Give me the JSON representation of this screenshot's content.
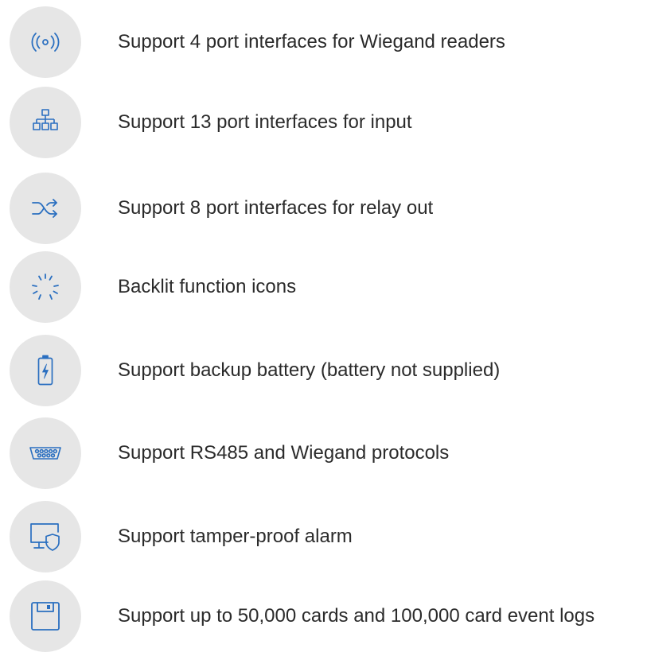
{
  "colors": {
    "icon_blue": "#2a6fc0",
    "circle_grey": "#e6e6e6",
    "text": "#2b2b2b"
  },
  "features": [
    {
      "icon": "wireless-signal-icon",
      "text": "Support 4 port interfaces for Wiegand readers"
    },
    {
      "icon": "network-hierarchy-icon",
      "text": "Support 13 port interfaces for input"
    },
    {
      "icon": "shuffle-arrows-icon",
      "text": "Support 8 port interfaces for relay out"
    },
    {
      "icon": "backlight-rays-icon",
      "text": "Backlit function icons"
    },
    {
      "icon": "battery-charge-icon",
      "text": "Support backup battery (battery not supplied)"
    },
    {
      "icon": "serial-port-icon",
      "text": "Support RS485 and Wiegand protocols"
    },
    {
      "icon": "monitor-shield-icon",
      "text": "Support tamper-proof alarm"
    },
    {
      "icon": "floppy-disk-icon",
      "text": "Support up to 50,000 cards and 100,000 card event logs"
    }
  ]
}
